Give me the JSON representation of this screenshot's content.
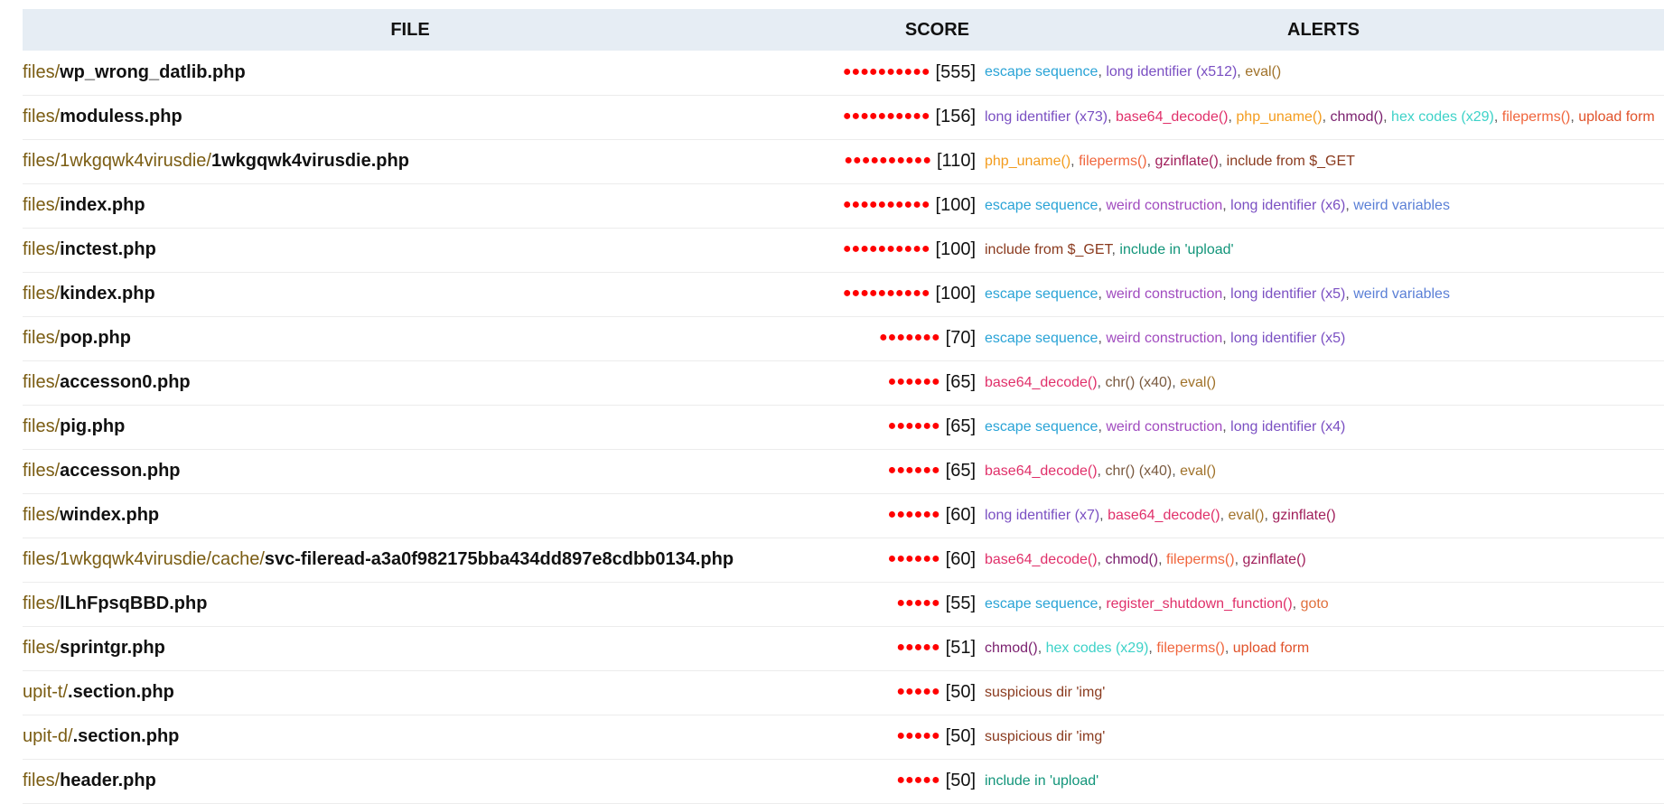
{
  "header": {
    "file": "FILE",
    "score": "SCORE",
    "alerts": "ALERTS"
  },
  "colors": {
    "escape sequence": "#29a3d6",
    "long identifier": "#7a4fc2",
    "eval()": "#a0722a",
    "base64_decode()": "#e0306a",
    "php_uname()": "#f39c1e",
    "chmod()": "#7a1f6e",
    "hex codes": "#3dd2c8",
    "fileperms()": "#f0653c",
    "upload form": "#e0522a",
    "gzinflate()": "#a01e5a",
    "include from $_GET": "#8a3a1e",
    "weird construction": "#a04bbf",
    "weird variables": "#5a7fd6",
    "include in 'upload'": "#12957a",
    "chr()": "#7a5a40",
    "register_shutdown_function()": "#e0306a",
    "goto": "#e0703c",
    "suspicious dir": "#8a3a1e",
    "dots": "#ff0000",
    "dir_text": "#7a5c12"
  },
  "rows": [
    {
      "dir": "files/",
      "name": "wp_wrong_datlib.php",
      "dots": 10,
      "score": "[555]",
      "alerts": [
        {
          "t": "escape sequence",
          "c": "escape sequence"
        },
        {
          "t": "long identifier (x512)",
          "c": "long identifier"
        },
        {
          "t": "eval()",
          "c": "eval()"
        }
      ]
    },
    {
      "dir": "files/",
      "name": "moduless.php",
      "dots": 10,
      "score": "[156]",
      "alerts": [
        {
          "t": "long identifier (x73)",
          "c": "long identifier"
        },
        {
          "t": "base64_decode()",
          "c": "base64_decode()"
        },
        {
          "t": "php_uname()",
          "c": "php_uname()"
        },
        {
          "t": "chmod()",
          "c": "chmod()"
        },
        {
          "t": "hex codes (x29)",
          "c": "hex codes"
        },
        {
          "t": "fileperms()",
          "c": "fileperms()"
        },
        {
          "t": "upload form",
          "c": "upload form"
        }
      ]
    },
    {
      "dir": "files/1wkgqwk4virusdie/",
      "name": "1wkgqwk4virusdie.php",
      "dots": 10,
      "score": "[110]",
      "alerts": [
        {
          "t": "php_uname()",
          "c": "php_uname()"
        },
        {
          "t": "fileperms()",
          "c": "fileperms()"
        },
        {
          "t": "gzinflate()",
          "c": "gzinflate()"
        },
        {
          "t": "include from $_GET",
          "c": "include from $_GET"
        }
      ]
    },
    {
      "dir": "files/",
      "name": "index.php",
      "dots": 10,
      "score": "[100]",
      "alerts": [
        {
          "t": "escape sequence",
          "c": "escape sequence"
        },
        {
          "t": "weird construction",
          "c": "weird construction"
        },
        {
          "t": "long identifier (x6)",
          "c": "long identifier"
        },
        {
          "t": "weird variables",
          "c": "weird variables"
        }
      ]
    },
    {
      "dir": "files/",
      "name": "inctest.php",
      "dots": 10,
      "score": "[100]",
      "alerts": [
        {
          "t": "include from $_GET",
          "c": "include from $_GET"
        },
        {
          "t": "include in 'upload'",
          "c": "include in 'upload'"
        }
      ]
    },
    {
      "dir": "files/",
      "name": "kindex.php",
      "dots": 10,
      "score": "[100]",
      "alerts": [
        {
          "t": "escape sequence",
          "c": "escape sequence"
        },
        {
          "t": "weird construction",
          "c": "weird construction"
        },
        {
          "t": "long identifier (x5)",
          "c": "long identifier"
        },
        {
          "t": "weird variables",
          "c": "weird variables"
        }
      ]
    },
    {
      "dir": "files/",
      "name": "pop.php",
      "dots": 7,
      "score": "[70]",
      "alerts": [
        {
          "t": "escape sequence",
          "c": "escape sequence"
        },
        {
          "t": "weird construction",
          "c": "weird construction"
        },
        {
          "t": "long identifier (x5)",
          "c": "long identifier"
        }
      ]
    },
    {
      "dir": "files/",
      "name": "accesson0.php",
      "dots": 6,
      "score": "[65]",
      "alerts": [
        {
          "t": "base64_decode()",
          "c": "base64_decode()"
        },
        {
          "t": "chr() (x40)",
          "c": "chr()"
        },
        {
          "t": "eval()",
          "c": "eval()"
        }
      ]
    },
    {
      "dir": "files/",
      "name": "pig.php",
      "dots": 6,
      "score": "[65]",
      "alerts": [
        {
          "t": "escape sequence",
          "c": "escape sequence"
        },
        {
          "t": "weird construction",
          "c": "weird construction"
        },
        {
          "t": "long identifier (x4)",
          "c": "long identifier"
        }
      ]
    },
    {
      "dir": "files/",
      "name": "accesson.php",
      "dots": 6,
      "score": "[65]",
      "alerts": [
        {
          "t": "base64_decode()",
          "c": "base64_decode()"
        },
        {
          "t": "chr() (x40)",
          "c": "chr()"
        },
        {
          "t": "eval()",
          "c": "eval()"
        }
      ]
    },
    {
      "dir": "files/",
      "name": "windex.php",
      "dots": 6,
      "score": "[60]",
      "alerts": [
        {
          "t": "long identifier (x7)",
          "c": "long identifier"
        },
        {
          "t": "base64_decode()",
          "c": "base64_decode()"
        },
        {
          "t": "eval()",
          "c": "eval()"
        },
        {
          "t": "gzinflate()",
          "c": "gzinflate()"
        }
      ]
    },
    {
      "dir": "files/1wkgqwk4virusdie/cache/",
      "name": "svc-fileread-a3a0f982175bba434dd897e8cdbb0134.php",
      "dots": 6,
      "score": "[60]",
      "alerts": [
        {
          "t": "base64_decode()",
          "c": "base64_decode()"
        },
        {
          "t": "chmod()",
          "c": "chmod()"
        },
        {
          "t": "fileperms()",
          "c": "fileperms()"
        },
        {
          "t": "gzinflate()",
          "c": "gzinflate()"
        }
      ]
    },
    {
      "dir": "files/",
      "name": "lLhFpsqBBD.php",
      "dots": 5,
      "score": "[55]",
      "alerts": [
        {
          "t": "escape sequence",
          "c": "escape sequence"
        },
        {
          "t": "register_shutdown_function()",
          "c": "register_shutdown_function()"
        },
        {
          "t": "goto",
          "c": "goto"
        }
      ]
    },
    {
      "dir": "files/",
      "name": "sprintgr.php",
      "dots": 5,
      "score": "[51]",
      "alerts": [
        {
          "t": "chmod()",
          "c": "chmod()"
        },
        {
          "t": "hex codes (x29)",
          "c": "hex codes"
        },
        {
          "t": "fileperms()",
          "c": "fileperms()"
        },
        {
          "t": "upload form",
          "c": "upload form"
        }
      ]
    },
    {
      "dir": "upit-t/",
      "name": ".section.php",
      "dots": 5,
      "score": "[50]",
      "alerts": [
        {
          "t": "suspicious dir 'img'",
          "c": "suspicious dir"
        }
      ]
    },
    {
      "dir": "upit-d/",
      "name": ".section.php",
      "dots": 5,
      "score": "[50]",
      "alerts": [
        {
          "t": "suspicious dir 'img'",
          "c": "suspicious dir"
        }
      ]
    },
    {
      "dir": "files/",
      "name": "header.php",
      "dots": 5,
      "score": "[50]",
      "alerts": [
        {
          "t": "include in 'upload'",
          "c": "include in 'upload'"
        }
      ]
    }
  ]
}
